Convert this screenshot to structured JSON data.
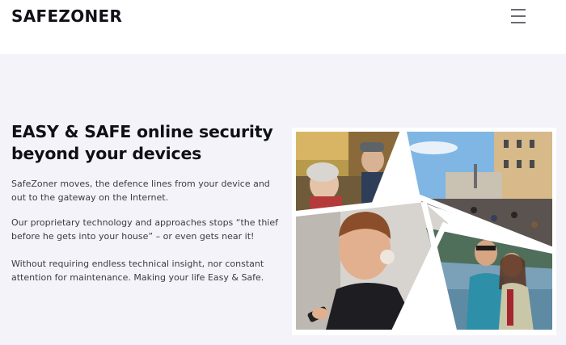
{
  "header": {
    "brand": "SAFEZONER",
    "menu_icon": "hamburger-menu-icon"
  },
  "hero": {
    "headline": "EASY & SAFE online security beyond your devices",
    "paragraphs": [
      "SafeZoner moves, the defence lines from your device and out to the gateway on the Internet.",
      "Our proprietary technology and approaches stops “the thief before he gets into your house” – or even gets near it!",
      "Without requiring endless technical insight, nor constant attention for maintenance. Making your life Easy & Safe."
    ]
  },
  "collage": {
    "panels": [
      "elderly-couple-photo",
      "city-street-crowd-photo",
      "man-with-headphones-and-phone-photo",
      "couple-hugging-by-lake-photo"
    ]
  },
  "colors": {
    "hero_background": "#f3f3f9",
    "header_background": "#ffffff",
    "headline": "#0f0f16",
    "body_text": "#3b3b44",
    "menu_icon": "#6a6a72"
  }
}
